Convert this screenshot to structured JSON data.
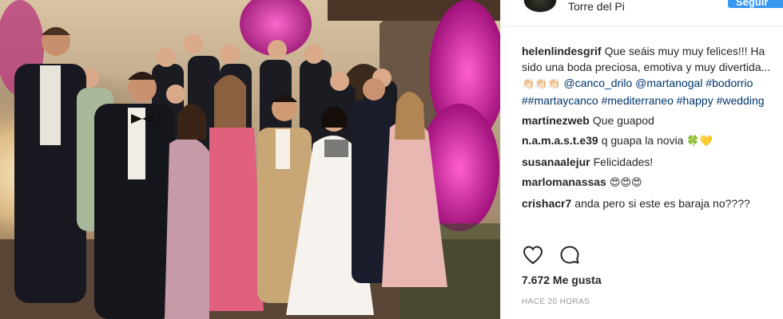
{
  "post": {
    "location": "Torre del Pi",
    "follow_label": "Seguir",
    "likes_label": "7.672 Me gusta",
    "timestamp": "HACE 20 HORAS"
  },
  "comments": [
    {
      "user": "helenlindesgrif",
      "text": "Que seáis muy muy felices!!! Ha sido una boda preciosa, emotiva y muy divertida... ",
      "emoji": "👏🏻👏🏻👏🏻",
      "mention": " @canco_drilo",
      "tags": "@martanogal #bodorrio ##martaycanco #mediterraneo #happy #wedding"
    },
    {
      "user": "martinezweb",
      "text": "Que guapod",
      "emoji": ""
    },
    {
      "user": "n.a.m.a.s.t.e39",
      "text": "q guapa la novia ",
      "emoji": "🍀💛"
    },
    {
      "user": "susanaalejur",
      "text": "Felicidades!",
      "emoji": ""
    },
    {
      "user": "marlomanassas",
      "text": "",
      "emoji": "😍😍😍"
    },
    {
      "user": "crishacr7",
      "text": "anda pero si este es baraja no????",
      "emoji": ""
    }
  ],
  "icons": {
    "like": "heart-icon",
    "comment": "comment-icon"
  },
  "colors": {
    "follow_button": "#3897f0",
    "hashtag": "#003569",
    "flowers": "#d6148f"
  }
}
